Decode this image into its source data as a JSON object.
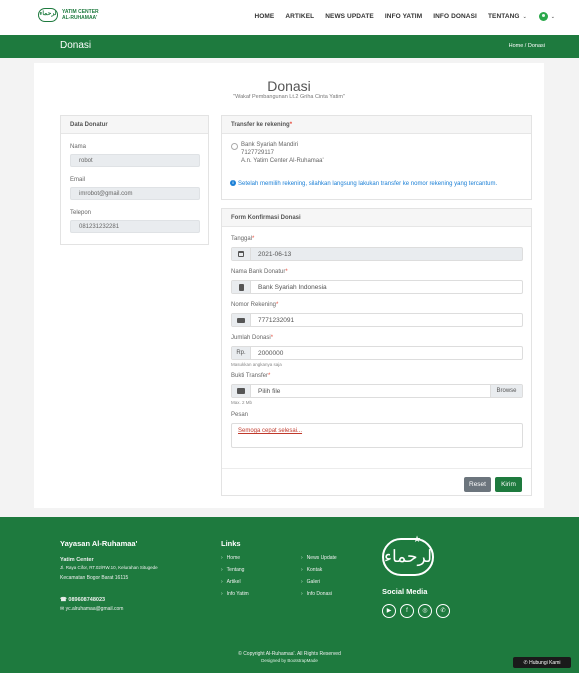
{
  "brand": {
    "logo_glyph": "لرحماء",
    "line1": "YATIM CENTER",
    "line2": "AL-RUHAMAA'"
  },
  "nav": {
    "items": [
      "HOME",
      "ARTIKEL",
      "NEWS UPDATE",
      "INFO YATIM",
      "INFO DONASI",
      "TENTANG"
    ],
    "tentang_caret": "⌄",
    "user_caret": "⌄"
  },
  "titlebar": {
    "title": "Donasi",
    "breadcrumb": "Home  /  Donasi"
  },
  "page": {
    "heading": "Donasi",
    "subheading": "\"Wakaf Pembangunan Lt.2 Griha Cinta Yatim\""
  },
  "donor": {
    "title": "Data Donatur",
    "name_label": "Nama",
    "name_value": "robot",
    "email_label": "Email",
    "email_value": "imrobot@gmail.com",
    "phone_label": "Telepon",
    "phone_value": "081231232281"
  },
  "transfer": {
    "title": "Transfer ke rekening",
    "bank_name": "Bank Syariah Mandiri",
    "account_number": "7127729117",
    "account_holder": "A.n. Yatim Center Al-Ruhamaa'",
    "info_icon": "i",
    "info": "Setelah memilih rekening, silahkan langsung lakukan transfer ke nomor rekening yang tercantum."
  },
  "form": {
    "title": "Form Konfirmasi Donasi",
    "date_label": "Tanggal",
    "date_value": "2021-06-13",
    "bank_label": "Nama Bank Donatur",
    "bank_value": "Bank Syariah Indonesia",
    "acct_label": "Nomor Rekening",
    "acct_value": "7771232091",
    "amount_label": "Jumlah Donasi",
    "amount_prefix": "Rp.",
    "amount_value": "2000000",
    "amount_hint": "Masukkan angkanya saja",
    "proof_label": "Bukti Transfer",
    "proof_value": "Pilih file",
    "browse": "Browse",
    "proof_hint": "Max. 2 Mb",
    "message_label": "Pesan",
    "message_value": "Semoga cepat selesai...",
    "reset": "Reset",
    "submit": "Kirim"
  },
  "footer": {
    "org": "Yayasan Al-Ruhamaa'",
    "center": "Yatim Center",
    "addr1": "Jl. Raya Cifor, RT.02/RW.10, Kelurahan Situgede",
    "addr2": "Kecamatan Bogor Barat 16115",
    "phone": "089608748023",
    "email": "yc.alruhamaa@gmail.com",
    "links_title": "Links",
    "links_col1": [
      "Home",
      "Tentang",
      "Artikel",
      "Info Yatim"
    ],
    "links_col2": [
      "News Update",
      "Kontak",
      "Galeri",
      "Info Donasi"
    ],
    "logo_glyph": "لرحماء",
    "social_title": "Social Media",
    "social_icons": [
      "▶",
      "f",
      "◎",
      "✆"
    ],
    "copyright": "© Copyright Al-Ruhamaa'. All Rights Reserved",
    "designed": "Designed by BootstrapMade",
    "whatsapp": "✆ Hubungi Kami"
  }
}
